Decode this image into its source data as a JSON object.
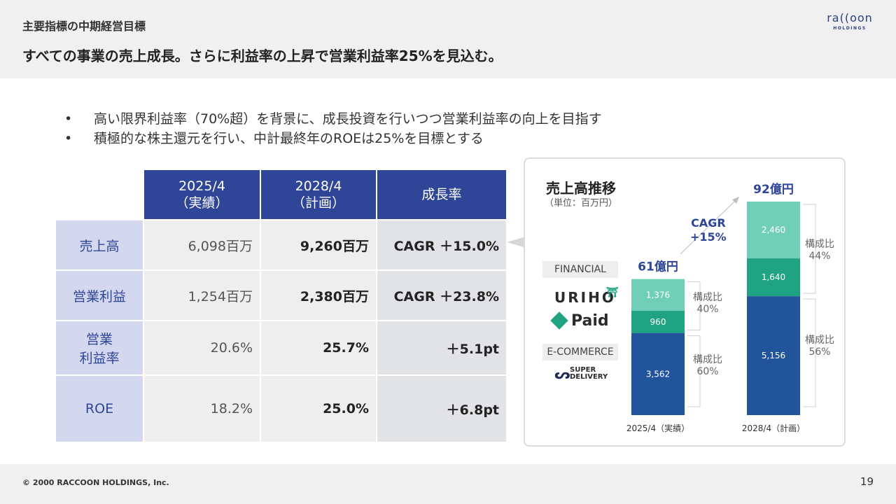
{
  "header": {
    "section_title": "主要指標の中期経営目標",
    "headline": "すべての事業の売上成長。さらに利益率の上昇で営業利益率25%を見込む。",
    "logo_main": "ra((oon",
    "logo_sub": "HOLDINGS"
  },
  "bullets": [
    "高い限界利益率（70%超）を背景に、成長投資を行いつつ営業利益率の向上を目指す",
    "積極的な株主還元を行い、中計最終年のROEは25%を目標とする"
  ],
  "table": {
    "headers": [
      {
        "line1": "2025/4",
        "line2": "（実績）"
      },
      {
        "line1": "2028/4",
        "line2": "（計画）"
      },
      {
        "line1": "成長率",
        "line2": ""
      }
    ],
    "rows": [
      {
        "label": "売上高",
        "label2": "",
        "actual": "6,098百万",
        "plan": "9,260百万",
        "growth": "CAGR ＋15.0%"
      },
      {
        "label": "営業利益",
        "label2": "",
        "actual": "1,254百万",
        "plan": "2,380百万",
        "growth": "CAGR ＋23.8%"
      },
      {
        "label": "営業",
        "label2": "利益率",
        "actual": "20.6%",
        "plan": "25.7%",
        "growth": "＋5.1pt"
      },
      {
        "label": "ROE",
        "label2": "",
        "actual": "18.2%",
        "plan": "25.0%",
        "growth": "＋6.8pt"
      }
    ]
  },
  "panel": {
    "title": "売上高推移",
    "unit": "（単位：百万円）",
    "segments": {
      "financial_label": "FINANCIAL",
      "ecommerce_label": "E-COMMERCE",
      "brand_urio": "URIHO",
      "brand_paid": "Paid",
      "brand_super1": "SUPER",
      "brand_super2": "DELIVERY"
    },
    "cagr_line1": "CAGR",
    "cagr_line2": "+15%"
  },
  "chart_data": {
    "type": "bar",
    "stacked": true,
    "categories": [
      "2025/4（実績）",
      "2028/4（計画）"
    ],
    "series": [
      {
        "name": "",
        "values": [
          3562,
          5156
        ],
        "color": "#22549b"
      },
      {
        "name": "",
        "values": [
          960,
          1640
        ],
        "color": "#1fa382"
      },
      {
        "name": "",
        "values": [
          1376,
          2460
        ],
        "color": "#6fcfb7"
      }
    ],
    "totals_labels": [
      "61億円",
      "92億円"
    ],
    "composition": [
      {
        "label": "構成比",
        "lower": "60%",
        "upper": "40%"
      },
      {
        "label": "構成比",
        "lower": "56%",
        "upper": "44%"
      }
    ],
    "value_labels": [
      [
        "3,562",
        "960",
        "1,376"
      ],
      [
        "5,156",
        "1,640",
        "2,460"
      ]
    ],
    "accent_color": "#2f4598"
  },
  "footer": {
    "copyright": "© 2000 RACCOON HOLDINGS, Inc.",
    "page": "19"
  }
}
